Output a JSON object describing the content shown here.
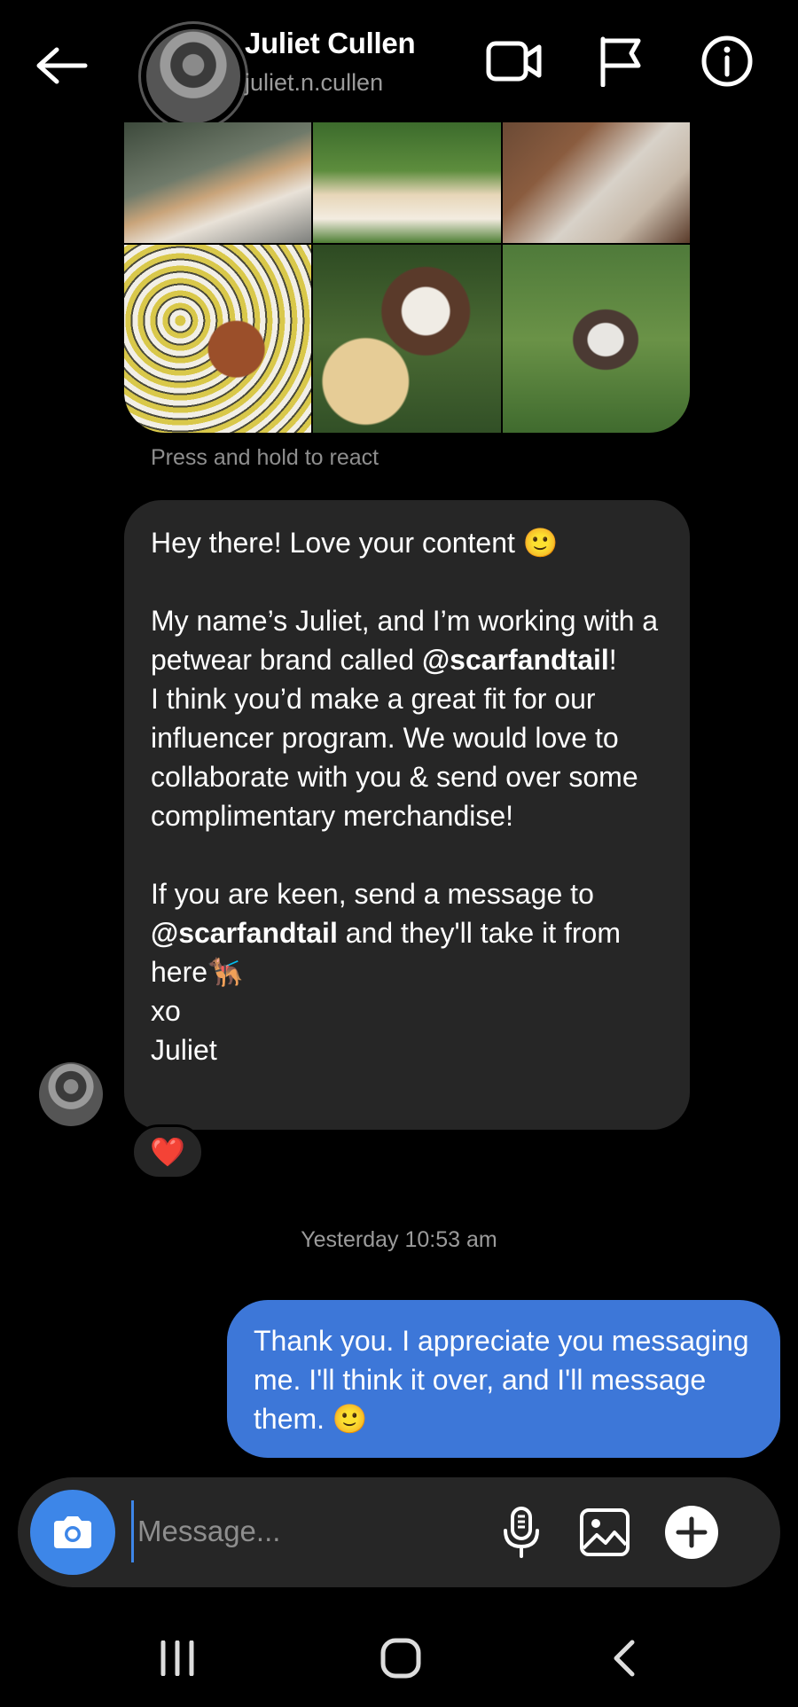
{
  "header": {
    "name": "Juliet Cullen",
    "username": "juliet.n.cullen",
    "icons": [
      "back-arrow-icon",
      "video-camera-icon",
      "flag-icon",
      "info-icon"
    ]
  },
  "photo_grid": {
    "caption": "Press and hold to react",
    "photos": 6
  },
  "incoming_message": {
    "line1": "Hey there! Love your content 🙂",
    "line2": "My name’s Juliet, and I’m working with a petwear brand called ",
    "mention1": "@scarfandtail",
    "line2_end": "!",
    "line3": "I think you’d make a great fit for our influencer program. We would love to collaborate with you & send over some complimentary merchandise!",
    "line4_start": "If you are keen, send a message to ",
    "mention2": "@scarfandtail",
    "line4_end": " and they'll take it from here🐕‍🦺",
    "signoff1": "xo",
    "signoff2": "Juliet",
    "reaction": "❤️"
  },
  "timestamp": "Yesterday 10:53 am",
  "outgoing_message": {
    "text": "Thank you. I appreciate you messaging me. I'll think it over, and I'll message them. 🙂"
  },
  "composer": {
    "placeholder": "Message...",
    "icons": [
      "camera-icon",
      "microphone-icon",
      "gallery-icon",
      "plus-icon"
    ]
  },
  "colors": {
    "background": "#000000",
    "incoming_bubble": "#262626",
    "outgoing_bubble": "#3d77d8",
    "accent": "#3d86e8"
  }
}
